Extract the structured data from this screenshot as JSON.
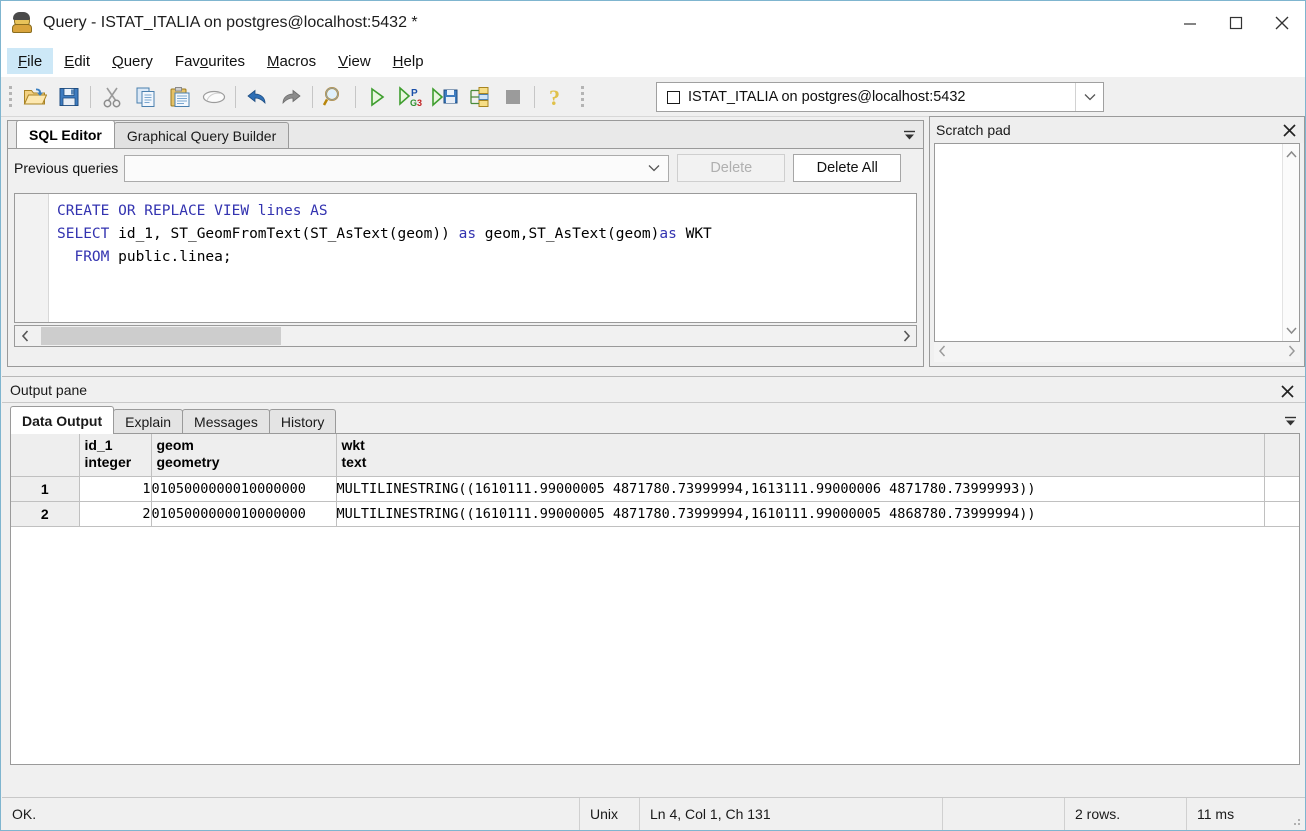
{
  "window": {
    "title": "Query - ISTAT_ITALIA on postgres@localhost:5432 *",
    "minimize_label": "Minimize",
    "maximize_label": "Maximize",
    "close_label": "Close"
  },
  "menubar": {
    "items": [
      {
        "label": "File",
        "accel": "F",
        "rest": "ile",
        "active": true
      },
      {
        "label": "Edit",
        "accel": "E",
        "rest": "dit",
        "active": false
      },
      {
        "label": "Query",
        "accel": "Q",
        "rest": "uery",
        "active": false
      },
      {
        "label": "Favourites",
        "accel": "",
        "rest": "",
        "active": false
      },
      {
        "label": "Macros",
        "accel": "M",
        "rest": "acros",
        "active": false
      },
      {
        "label": "View",
        "accel": "V",
        "rest": "iew",
        "active": false
      },
      {
        "label": "Help",
        "accel": "H",
        "rest": "elp",
        "active": false
      }
    ]
  },
  "toolbar": {
    "buttons": [
      {
        "name": "open-file-icon",
        "tooltip": "Open file"
      },
      {
        "name": "save-file-icon",
        "tooltip": "Save"
      },
      {
        "name": "separator",
        "tooltip": ""
      },
      {
        "name": "cut-icon",
        "tooltip": "Cut"
      },
      {
        "name": "copy-icon",
        "tooltip": "Copy"
      },
      {
        "name": "paste-icon",
        "tooltip": "Paste"
      },
      {
        "name": "clear-window-icon",
        "tooltip": "Clear window"
      },
      {
        "name": "separator",
        "tooltip": ""
      },
      {
        "name": "undo-icon",
        "tooltip": "Undo"
      },
      {
        "name": "redo-icon",
        "tooltip": "Redo"
      },
      {
        "name": "separator",
        "tooltip": ""
      },
      {
        "name": "find-replace-icon",
        "tooltip": "Find and Replace"
      },
      {
        "name": "separator",
        "tooltip": ""
      },
      {
        "name": "execute-query-icon",
        "tooltip": "Execute query"
      },
      {
        "name": "execute-pgscript-icon",
        "tooltip": "Execute pgScript"
      },
      {
        "name": "execute-to-file-icon",
        "tooltip": "Execute query, write result to file"
      },
      {
        "name": "explain-query-icon",
        "tooltip": "Explain query"
      },
      {
        "name": "cancel-query-icon",
        "tooltip": "Cancel"
      },
      {
        "name": "separator",
        "tooltip": ""
      },
      {
        "name": "help-icon",
        "tooltip": "Help"
      }
    ],
    "connection": {
      "value": "ISTAT_ITALIA on postgres@localhost:5432"
    }
  },
  "editor_panel": {
    "tabs": [
      {
        "label": "SQL Editor",
        "selected": true
      },
      {
        "label": "Graphical Query Builder",
        "selected": false
      }
    ],
    "previous_queries": {
      "label": "Previous queries",
      "value": "",
      "placeholder": ""
    },
    "delete_button": "Delete",
    "delete_all_button": "Delete All",
    "sql": {
      "lines": [
        [
          {
            "t": "CREATE OR REPLACE VIEW lines AS",
            "kw": true
          }
        ],
        [
          {
            "t": "SELECT",
            "kw": true
          },
          {
            "t": " id_1, ST_GeomFromText(ST_AsText(geom)) ",
            "kw": false
          },
          {
            "t": "as",
            "kw": true
          },
          {
            "t": " geom,ST_AsText(geom)",
            "kw": false
          },
          {
            "t": "as",
            "kw": true
          },
          {
            "t": " WKT",
            "kw": false
          }
        ],
        [
          {
            "t": "  ",
            "kw": false
          },
          {
            "t": "FROM",
            "kw": true
          },
          {
            "t": " public.linea;",
            "kw": false
          }
        ]
      ]
    }
  },
  "scratch_pad": {
    "title": "Scratch pad",
    "content": "",
    "close_label": "Close"
  },
  "output_pane": {
    "title": "Output pane",
    "close_label": "Close",
    "tabs": [
      {
        "label": "Data Output",
        "selected": true
      },
      {
        "label": "Explain",
        "selected": false
      },
      {
        "label": "Messages",
        "selected": false
      },
      {
        "label": "History",
        "selected": false
      }
    ],
    "grid": {
      "columns": [
        {
          "name": "id_1",
          "type": "integer"
        },
        {
          "name": "geom",
          "type": "geometry"
        },
        {
          "name": "wkt",
          "type": "text"
        }
      ],
      "rows": [
        {
          "num": "1",
          "id_1": "1",
          "geom": "0105000000010000000",
          "wkt": "MULTILINESTRING((1610111.99000005 4871780.73999994,1613111.99000006 4871780.73999993))"
        },
        {
          "num": "2",
          "id_1": "2",
          "geom": "0105000000010000000",
          "wkt": "MULTILINESTRING((1610111.99000005 4871780.73999994,1610111.99000005 4868780.73999994))"
        }
      ]
    }
  },
  "statusbar": {
    "message": "OK.",
    "line_ending": "Unix",
    "position": "Ln 4, Col 1, Ch 131",
    "spacer": "",
    "rows": "2 rows.",
    "duration": "11 ms"
  },
  "colors": {
    "keyword": "#3333b0",
    "menu_highlight": "#cde8f7",
    "window_border": "#7fb5cf"
  }
}
